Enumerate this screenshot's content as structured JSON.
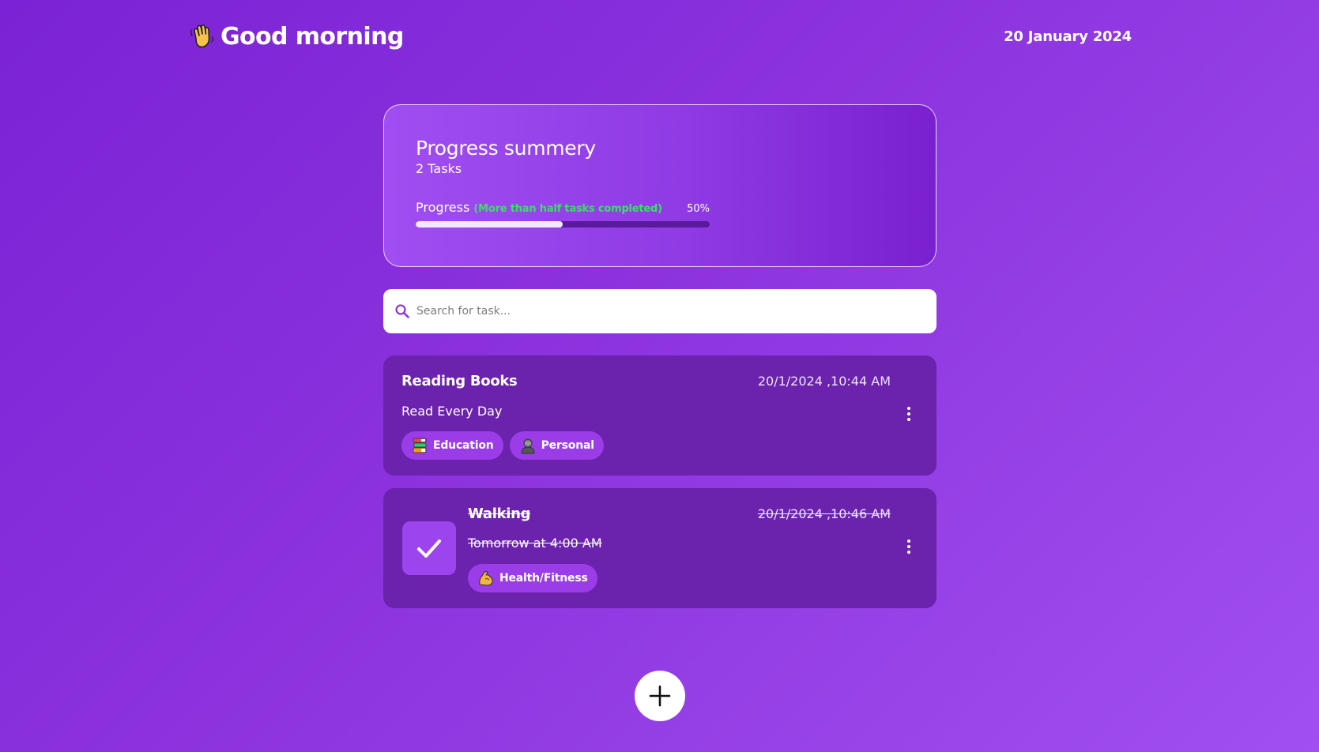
{
  "header": {
    "greeting": "Good morning",
    "greeting_icon": "waving-hand-icon",
    "date": "20 January 2024"
  },
  "summary": {
    "title": "Progress summery",
    "task_count": "2 Tasks",
    "progress_label": "Progress",
    "progress_hint": "(More than half tasks completed)",
    "progress_percent_text": "50%",
    "progress_value": 0.5,
    "hint_color": "#3ddc6b"
  },
  "search": {
    "placeholder": "Search for task...",
    "icon": "search-icon"
  },
  "tasks": [
    {
      "name": "Reading Books",
      "timestamp": "20/1/2024 ,10:44 AM",
      "description": "Read Every Day",
      "completed": false,
      "categories": [
        {
          "label": "Education",
          "icon": "books-icon"
        },
        {
          "label": "Personal",
          "icon": "person-icon"
        }
      ]
    },
    {
      "name": "Walking",
      "timestamp": "20/1/2024 ,10:46 AM",
      "description": "Tomorrow at 4:00 AM",
      "completed": true,
      "categories": [
        {
          "label": "Health/Fitness",
          "icon": "flexed-biceps-icon"
        }
      ]
    }
  ],
  "colors": {
    "accent": "#8c33de",
    "card": "#6b22ad",
    "chip": "#9a3de8"
  },
  "fab_icon": "plus-icon"
}
